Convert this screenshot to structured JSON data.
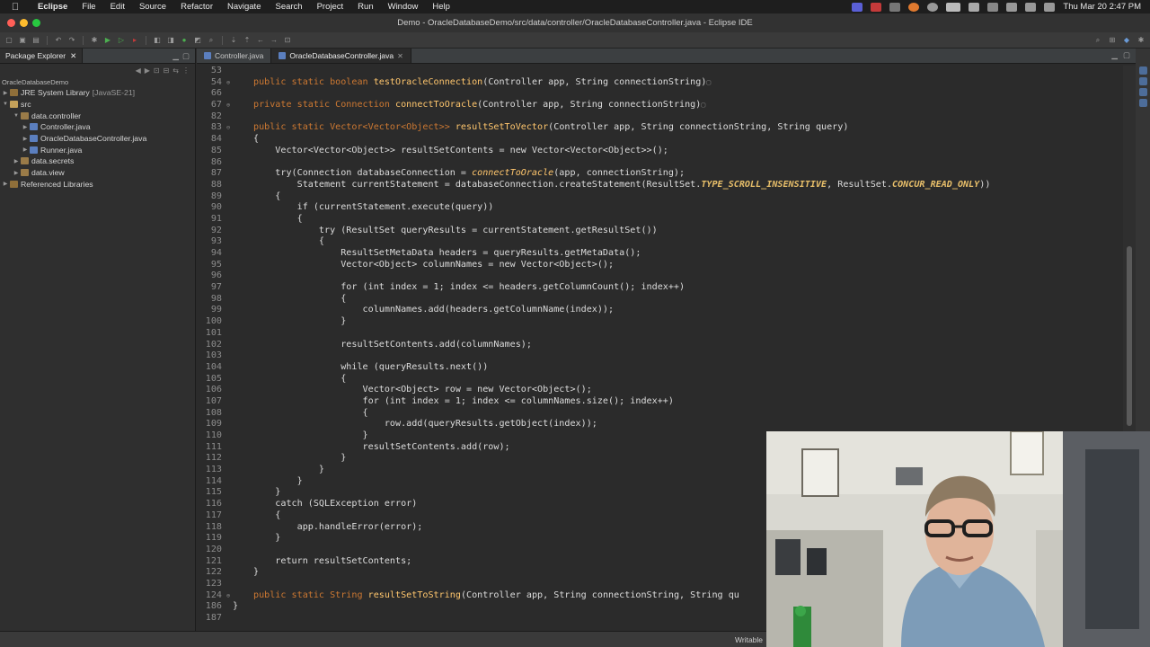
{
  "menubar": {
    "app_name": "Eclipse",
    "items": [
      "File",
      "Edit",
      "Source",
      "Refactor",
      "Navigate",
      "Search",
      "Project",
      "Run",
      "Window",
      "Help"
    ],
    "clock": "Thu Mar 20  2:47 PM"
  },
  "window": {
    "title": "Demo - OracleDatabaseDemo/src/data/controller/OracleDatabaseController.java - Eclipse IDE"
  },
  "explorer": {
    "tab_label": "Package Explorer",
    "project": "OracleDatabaseDemo",
    "items": [
      {
        "label": "JRE System Library",
        "suffix": "[JavaSE-21]"
      },
      {
        "label": "src"
      },
      {
        "label": "data.controller"
      },
      {
        "label": "Controller.java"
      },
      {
        "label": "OracleDatabaseController.java"
      },
      {
        "label": "Runner.java"
      },
      {
        "label": "data.secrets"
      },
      {
        "label": "data.view"
      },
      {
        "label": "Referenced Libraries"
      }
    ]
  },
  "editor": {
    "tabs": [
      "Controller.java",
      "OracleDatabaseController.java"
    ],
    "line_numbers": [
      "53",
      "54",
      "66",
      "67",
      "82",
      "83",
      "84",
      "85",
      "86",
      "87",
      "88",
      "89",
      "90",
      "91",
      "92",
      "93",
      "94",
      "95",
      "96",
      "97",
      "98",
      "99",
      "100",
      "101",
      "102",
      "103",
      "104",
      "105",
      "106",
      "107",
      "108",
      "109",
      "110",
      "111",
      "112",
      "113",
      "114",
      "115",
      "116",
      "117",
      "118",
      "119",
      "120",
      "121",
      "122",
      "123",
      "124",
      "186",
      "187"
    ],
    "code": {
      "l54a": "public static boolean ",
      "l54b": "testOracleConnection",
      "l54c": "(Controller app, String connectionString)",
      "l67a": "private static Connection ",
      "l67b": "connectToOracle",
      "l67c": "(Controller app, String connectionString)",
      "l83a": "public static Vector<Vector<Object>> ",
      "l83b": "resultSetToVector",
      "l83c": "(Controller app, String connectionString, String query)",
      "l84": "{",
      "l85": "    Vector<Vector<Object>> resultSetContents = new Vector<Vector<Object>>();",
      "l87a": "    try(Connection databaseConnection = ",
      "l87b": "connectToOracle",
      "l87c": "(app, connectionString);",
      "l88a": "        Statement currentStatement = databaseConnection.createStatement(ResultSet.",
      "l88b": "TYPE_SCROLL_INSENSITIVE",
      "l88c": ", ResultSet.",
      "l88d": "CONCUR_READ_ONLY",
      "l88e": "))",
      "l89": "    {",
      "l90": "        if (currentStatement.execute(query))",
      "l91": "        {",
      "l92": "            try (ResultSet queryResults = currentStatement.getResultSet())",
      "l93": "            {",
      "l94": "                ResultSetMetaData headers = queryResults.getMetaData();",
      "l95": "                Vector<Object> columnNames = new Vector<Object>();",
      "l97": "                for (int index = 1; index <= headers.getColumnCount(); index++)",
      "l98": "                {",
      "l99": "                    columnNames.add(headers.getColumnName(index));",
      "l100": "                }",
      "l102": "                resultSetContents.add(columnNames);",
      "l104": "                while (queryResults.next())",
      "l105": "                {",
      "l106": "                    Vector<Object> row = new Vector<Object>();",
      "l107": "                    for (int index = 1; index <= columnNames.size(); index++)",
      "l108": "                    {",
      "l109": "                        row.add(queryResults.getObject(index));",
      "l110": "                    }",
      "l111": "                    resultSetContents.add(row);",
      "l112": "                }",
      "l113": "            }",
      "l114": "        }",
      "l115": "    }",
      "l116": "    catch (SQLException error)",
      "l117": "    {",
      "l118": "        app.handleError(error);",
      "l119": "    }",
      "l121": "    return resultSetContents;",
      "l122": "}",
      "l124a": "public static String ",
      "l124b": "resultSetToString",
      "l124c": "(Controller app, String connectionString, String qu",
      "l186": "}"
    }
  },
  "statusbar": {
    "writable": "Writable"
  }
}
